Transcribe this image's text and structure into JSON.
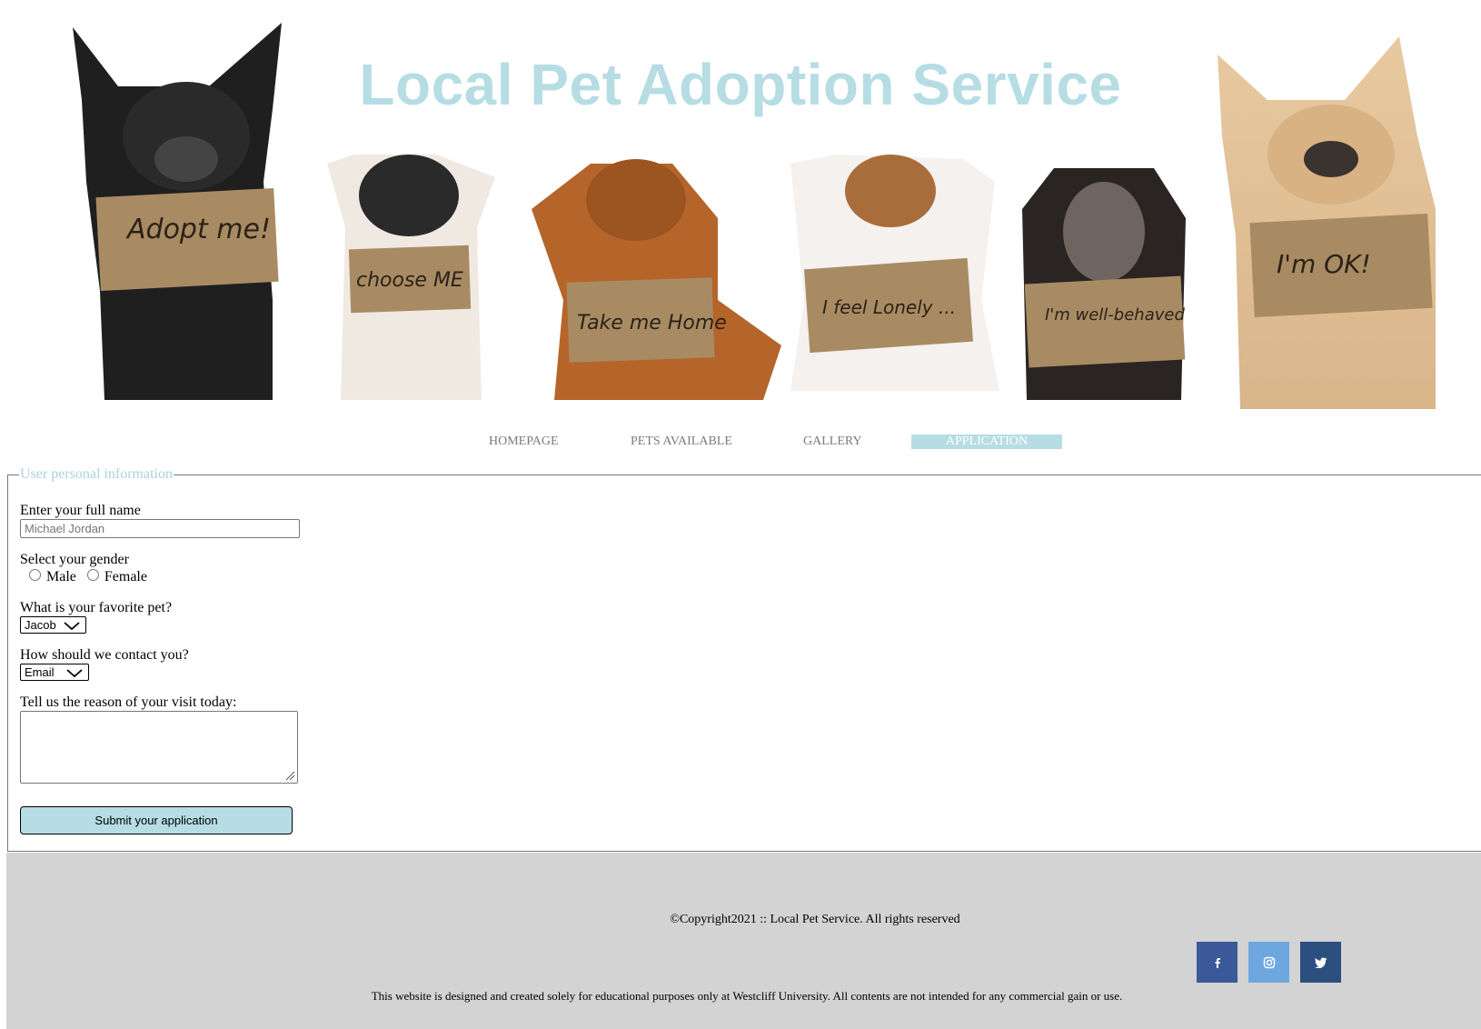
{
  "header": {
    "title": "Local Pet Adoption Service",
    "title_color": "#b6dde4",
    "dog_signs": [
      "Adopt me!",
      "choose ME",
      "Take me Home",
      "I feel Lonely ...",
      "I'm well-behaved",
      "I'm OK!"
    ]
  },
  "nav": {
    "items": [
      {
        "label": "HOMEPAGE",
        "active": false
      },
      {
        "label": "PETS AVAILABLE",
        "active": false
      },
      {
        "label": "GALLERY",
        "active": false
      },
      {
        "label": "APPLICATION",
        "active": true
      }
    ],
    "accent_color": "#b6dde4"
  },
  "form": {
    "legend": "User personal information",
    "name_label": "Enter your full name",
    "name_placeholder": "Michael Jordan",
    "name_value": "",
    "gender_label": "Select your gender",
    "gender_options": [
      "Male",
      "Female"
    ],
    "pet_label": "What is your favorite pet?",
    "pet_selected": "Jacob",
    "contact_label": "How should we contact you?",
    "contact_selected": "Email",
    "reason_label": "Tell us the reason of your visit today:",
    "reason_value": "",
    "submit_label": "Submit your application",
    "submit_color": "#b6dde4"
  },
  "footer": {
    "copyright": "©Copyright2021 :: Local Pet Service. All rights reserved",
    "disclaimer": "This website is designed and created solely for educational purposes only at Westcliff University. All contents are not intended for any commercial gain or use.",
    "background": "#d3d3d3",
    "social": [
      {
        "icon": "facebook-icon",
        "color": "#3b5998"
      },
      {
        "icon": "instagram-icon",
        "color": "#6ea7e0"
      },
      {
        "icon": "twitter-icon",
        "color": "#2b4f7e"
      }
    ]
  }
}
